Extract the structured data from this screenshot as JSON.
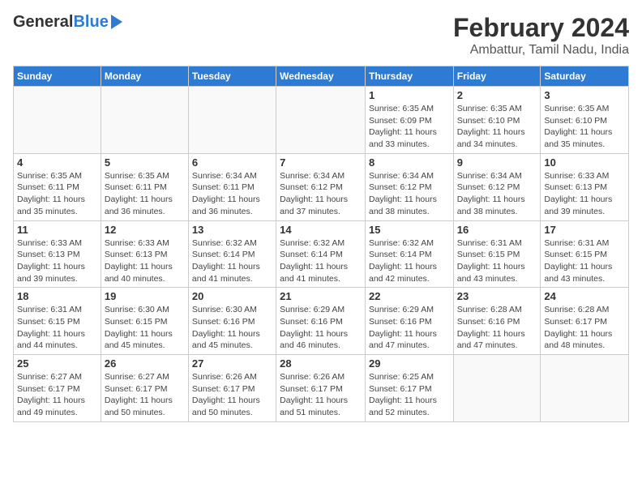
{
  "header": {
    "logo_general": "General",
    "logo_blue": "Blue",
    "month_year": "February 2024",
    "location": "Ambattur, Tamil Nadu, India"
  },
  "days_of_week": [
    "Sunday",
    "Monday",
    "Tuesday",
    "Wednesday",
    "Thursday",
    "Friday",
    "Saturday"
  ],
  "weeks": [
    [
      {
        "date": "",
        "info": ""
      },
      {
        "date": "",
        "info": ""
      },
      {
        "date": "",
        "info": ""
      },
      {
        "date": "",
        "info": ""
      },
      {
        "date": "1",
        "info": "Sunrise: 6:35 AM\nSunset: 6:09 PM\nDaylight: 11 hours and 33 minutes."
      },
      {
        "date": "2",
        "info": "Sunrise: 6:35 AM\nSunset: 6:10 PM\nDaylight: 11 hours and 34 minutes."
      },
      {
        "date": "3",
        "info": "Sunrise: 6:35 AM\nSunset: 6:10 PM\nDaylight: 11 hours and 35 minutes."
      }
    ],
    [
      {
        "date": "4",
        "info": "Sunrise: 6:35 AM\nSunset: 6:11 PM\nDaylight: 11 hours and 35 minutes."
      },
      {
        "date": "5",
        "info": "Sunrise: 6:35 AM\nSunset: 6:11 PM\nDaylight: 11 hours and 36 minutes."
      },
      {
        "date": "6",
        "info": "Sunrise: 6:34 AM\nSunset: 6:11 PM\nDaylight: 11 hours and 36 minutes."
      },
      {
        "date": "7",
        "info": "Sunrise: 6:34 AM\nSunset: 6:12 PM\nDaylight: 11 hours and 37 minutes."
      },
      {
        "date": "8",
        "info": "Sunrise: 6:34 AM\nSunset: 6:12 PM\nDaylight: 11 hours and 38 minutes."
      },
      {
        "date": "9",
        "info": "Sunrise: 6:34 AM\nSunset: 6:12 PM\nDaylight: 11 hours and 38 minutes."
      },
      {
        "date": "10",
        "info": "Sunrise: 6:33 AM\nSunset: 6:13 PM\nDaylight: 11 hours and 39 minutes."
      }
    ],
    [
      {
        "date": "11",
        "info": "Sunrise: 6:33 AM\nSunset: 6:13 PM\nDaylight: 11 hours and 39 minutes."
      },
      {
        "date": "12",
        "info": "Sunrise: 6:33 AM\nSunset: 6:13 PM\nDaylight: 11 hours and 40 minutes."
      },
      {
        "date": "13",
        "info": "Sunrise: 6:32 AM\nSunset: 6:14 PM\nDaylight: 11 hours and 41 minutes."
      },
      {
        "date": "14",
        "info": "Sunrise: 6:32 AM\nSunset: 6:14 PM\nDaylight: 11 hours and 41 minutes."
      },
      {
        "date": "15",
        "info": "Sunrise: 6:32 AM\nSunset: 6:14 PM\nDaylight: 11 hours and 42 minutes."
      },
      {
        "date": "16",
        "info": "Sunrise: 6:31 AM\nSunset: 6:15 PM\nDaylight: 11 hours and 43 minutes."
      },
      {
        "date": "17",
        "info": "Sunrise: 6:31 AM\nSunset: 6:15 PM\nDaylight: 11 hours and 43 minutes."
      }
    ],
    [
      {
        "date": "18",
        "info": "Sunrise: 6:31 AM\nSunset: 6:15 PM\nDaylight: 11 hours and 44 minutes."
      },
      {
        "date": "19",
        "info": "Sunrise: 6:30 AM\nSunset: 6:15 PM\nDaylight: 11 hours and 45 minutes."
      },
      {
        "date": "20",
        "info": "Sunrise: 6:30 AM\nSunset: 6:16 PM\nDaylight: 11 hours and 45 minutes."
      },
      {
        "date": "21",
        "info": "Sunrise: 6:29 AM\nSunset: 6:16 PM\nDaylight: 11 hours and 46 minutes."
      },
      {
        "date": "22",
        "info": "Sunrise: 6:29 AM\nSunset: 6:16 PM\nDaylight: 11 hours and 47 minutes."
      },
      {
        "date": "23",
        "info": "Sunrise: 6:28 AM\nSunset: 6:16 PM\nDaylight: 11 hours and 47 minutes."
      },
      {
        "date": "24",
        "info": "Sunrise: 6:28 AM\nSunset: 6:17 PM\nDaylight: 11 hours and 48 minutes."
      }
    ],
    [
      {
        "date": "25",
        "info": "Sunrise: 6:27 AM\nSunset: 6:17 PM\nDaylight: 11 hours and 49 minutes."
      },
      {
        "date": "26",
        "info": "Sunrise: 6:27 AM\nSunset: 6:17 PM\nDaylight: 11 hours and 50 minutes."
      },
      {
        "date": "27",
        "info": "Sunrise: 6:26 AM\nSunset: 6:17 PM\nDaylight: 11 hours and 50 minutes."
      },
      {
        "date": "28",
        "info": "Sunrise: 6:26 AM\nSunset: 6:17 PM\nDaylight: 11 hours and 51 minutes."
      },
      {
        "date": "29",
        "info": "Sunrise: 6:25 AM\nSunset: 6:17 PM\nDaylight: 11 hours and 52 minutes."
      },
      {
        "date": "",
        "info": ""
      },
      {
        "date": "",
        "info": ""
      }
    ]
  ]
}
